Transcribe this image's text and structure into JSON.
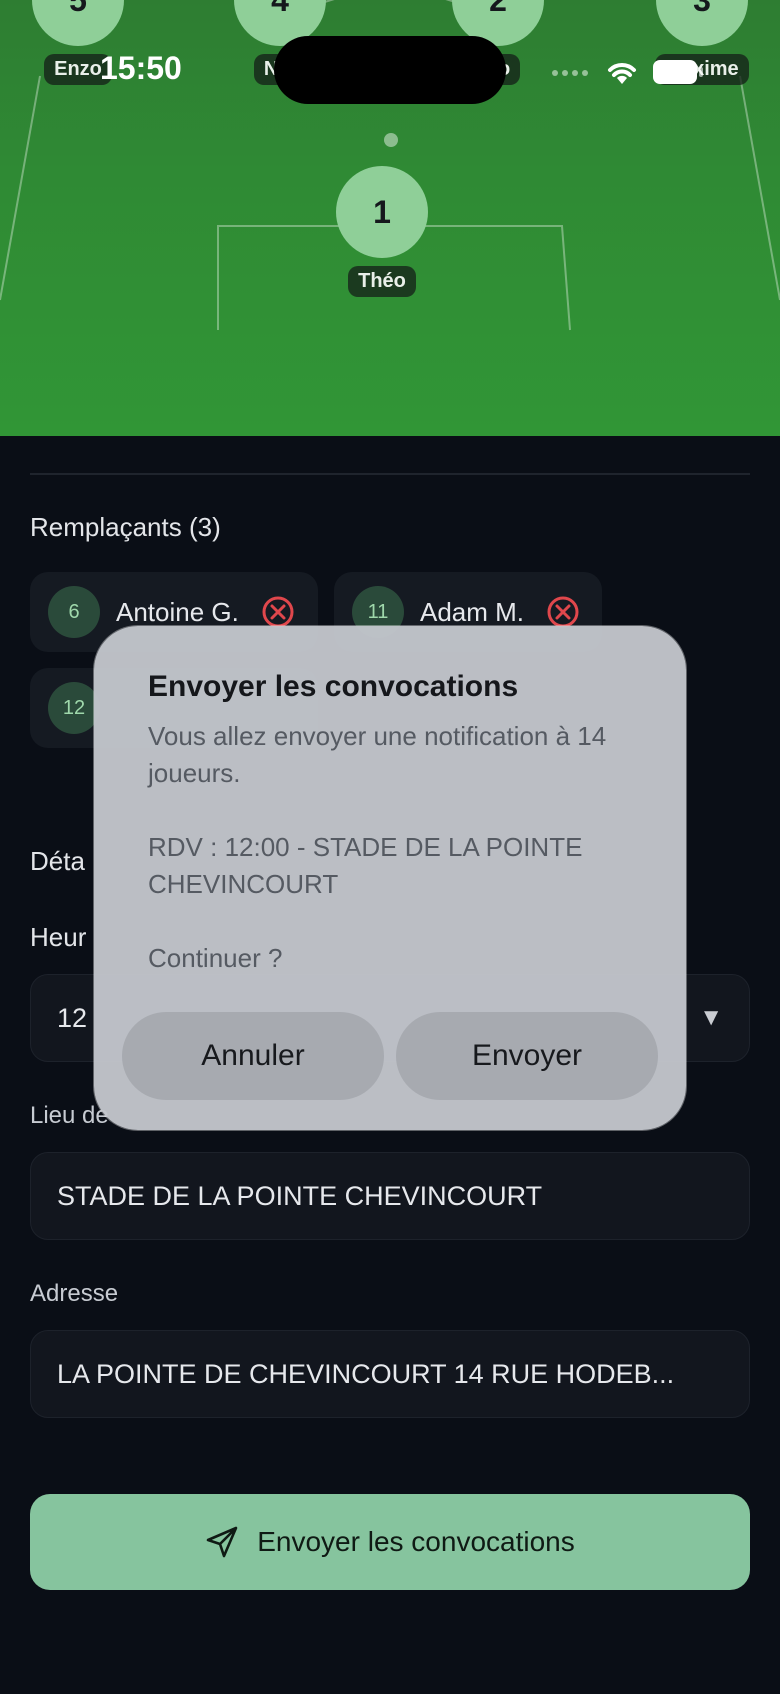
{
  "status_bar": {
    "time": "15:50"
  },
  "pitch": {
    "players": [
      {
        "number": "5",
        "name": "Enzo"
      },
      {
        "number": "4",
        "name": "Nat"
      },
      {
        "number": "2",
        "name": "go"
      },
      {
        "number": "3",
        "name": "Maxime"
      },
      {
        "number": "1",
        "name": "Théo"
      }
    ]
  },
  "substitutes": {
    "title": "Remplaçants (3)",
    "players": [
      {
        "number": "6",
        "name": "Antoine G."
      },
      {
        "number": "11",
        "name": "Adam M."
      },
      {
        "number": "12",
        "name": ""
      }
    ]
  },
  "details": {
    "title_partial": "Déta",
    "time_label_partial": "Heur",
    "time_value_partial": "12",
    "place_label_partial": "Lieu de",
    "place_value": "STADE DE LA POINTE CHEVINCOURT",
    "address_label": "Adresse",
    "address_value": "LA POINTE DE CHEVINCOURT 14 RUE HODEB..."
  },
  "send_button": {
    "label": "Envoyer les convocations"
  },
  "dialog": {
    "title": "Envoyer les convocations",
    "message": "Vous allez envoyer une notification à 14 joueurs.\n\nRDV : 12:00 - STADE DE LA POINTE CHEVINCOURT\n\nContinuer ?",
    "cancel_label": "Annuler",
    "confirm_label": "Envoyer"
  },
  "colors": {
    "pitch": "#2f8a34",
    "player_disc": "#8fcf98",
    "accent": "#86c49e",
    "remove": "#e0474c",
    "background": "#0a0e16"
  }
}
